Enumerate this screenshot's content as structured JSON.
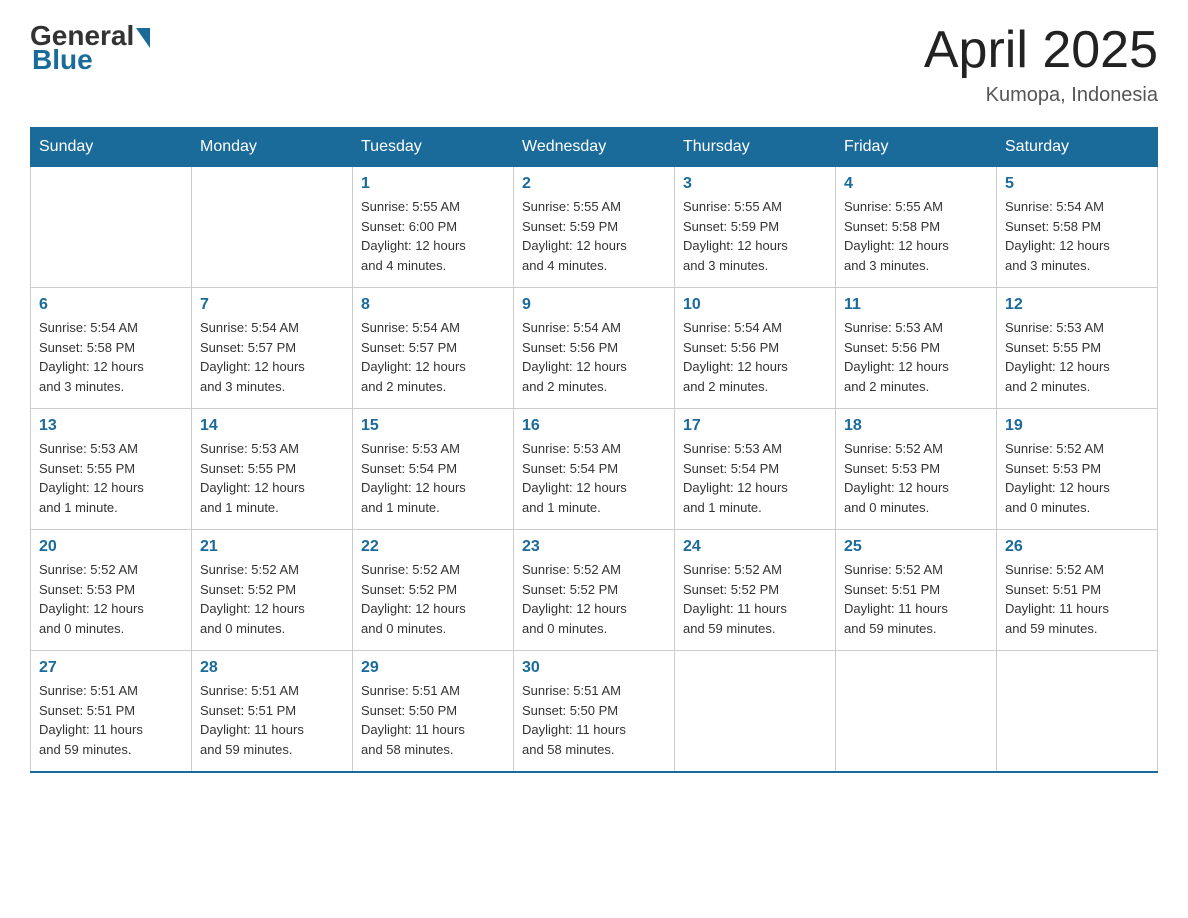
{
  "header": {
    "logo_general": "General",
    "logo_blue": "Blue",
    "month_title": "April 2025",
    "location": "Kumopa, Indonesia"
  },
  "weekdays": [
    "Sunday",
    "Monday",
    "Tuesday",
    "Wednesday",
    "Thursday",
    "Friday",
    "Saturday"
  ],
  "weeks": [
    [
      {
        "day": "",
        "info": ""
      },
      {
        "day": "",
        "info": ""
      },
      {
        "day": "1",
        "info": "Sunrise: 5:55 AM\nSunset: 6:00 PM\nDaylight: 12 hours\nand 4 minutes."
      },
      {
        "day": "2",
        "info": "Sunrise: 5:55 AM\nSunset: 5:59 PM\nDaylight: 12 hours\nand 4 minutes."
      },
      {
        "day": "3",
        "info": "Sunrise: 5:55 AM\nSunset: 5:59 PM\nDaylight: 12 hours\nand 3 minutes."
      },
      {
        "day": "4",
        "info": "Sunrise: 5:55 AM\nSunset: 5:58 PM\nDaylight: 12 hours\nand 3 minutes."
      },
      {
        "day": "5",
        "info": "Sunrise: 5:54 AM\nSunset: 5:58 PM\nDaylight: 12 hours\nand 3 minutes."
      }
    ],
    [
      {
        "day": "6",
        "info": "Sunrise: 5:54 AM\nSunset: 5:58 PM\nDaylight: 12 hours\nand 3 minutes."
      },
      {
        "day": "7",
        "info": "Sunrise: 5:54 AM\nSunset: 5:57 PM\nDaylight: 12 hours\nand 3 minutes."
      },
      {
        "day": "8",
        "info": "Sunrise: 5:54 AM\nSunset: 5:57 PM\nDaylight: 12 hours\nand 2 minutes."
      },
      {
        "day": "9",
        "info": "Sunrise: 5:54 AM\nSunset: 5:56 PM\nDaylight: 12 hours\nand 2 minutes."
      },
      {
        "day": "10",
        "info": "Sunrise: 5:54 AM\nSunset: 5:56 PM\nDaylight: 12 hours\nand 2 minutes."
      },
      {
        "day": "11",
        "info": "Sunrise: 5:53 AM\nSunset: 5:56 PM\nDaylight: 12 hours\nand 2 minutes."
      },
      {
        "day": "12",
        "info": "Sunrise: 5:53 AM\nSunset: 5:55 PM\nDaylight: 12 hours\nand 2 minutes."
      }
    ],
    [
      {
        "day": "13",
        "info": "Sunrise: 5:53 AM\nSunset: 5:55 PM\nDaylight: 12 hours\nand 1 minute."
      },
      {
        "day": "14",
        "info": "Sunrise: 5:53 AM\nSunset: 5:55 PM\nDaylight: 12 hours\nand 1 minute."
      },
      {
        "day": "15",
        "info": "Sunrise: 5:53 AM\nSunset: 5:54 PM\nDaylight: 12 hours\nand 1 minute."
      },
      {
        "day": "16",
        "info": "Sunrise: 5:53 AM\nSunset: 5:54 PM\nDaylight: 12 hours\nand 1 minute."
      },
      {
        "day": "17",
        "info": "Sunrise: 5:53 AM\nSunset: 5:54 PM\nDaylight: 12 hours\nand 1 minute."
      },
      {
        "day": "18",
        "info": "Sunrise: 5:52 AM\nSunset: 5:53 PM\nDaylight: 12 hours\nand 0 minutes."
      },
      {
        "day": "19",
        "info": "Sunrise: 5:52 AM\nSunset: 5:53 PM\nDaylight: 12 hours\nand 0 minutes."
      }
    ],
    [
      {
        "day": "20",
        "info": "Sunrise: 5:52 AM\nSunset: 5:53 PM\nDaylight: 12 hours\nand 0 minutes."
      },
      {
        "day": "21",
        "info": "Sunrise: 5:52 AM\nSunset: 5:52 PM\nDaylight: 12 hours\nand 0 minutes."
      },
      {
        "day": "22",
        "info": "Sunrise: 5:52 AM\nSunset: 5:52 PM\nDaylight: 12 hours\nand 0 minutes."
      },
      {
        "day": "23",
        "info": "Sunrise: 5:52 AM\nSunset: 5:52 PM\nDaylight: 12 hours\nand 0 minutes."
      },
      {
        "day": "24",
        "info": "Sunrise: 5:52 AM\nSunset: 5:52 PM\nDaylight: 11 hours\nand 59 minutes."
      },
      {
        "day": "25",
        "info": "Sunrise: 5:52 AM\nSunset: 5:51 PM\nDaylight: 11 hours\nand 59 minutes."
      },
      {
        "day": "26",
        "info": "Sunrise: 5:52 AM\nSunset: 5:51 PM\nDaylight: 11 hours\nand 59 minutes."
      }
    ],
    [
      {
        "day": "27",
        "info": "Sunrise: 5:51 AM\nSunset: 5:51 PM\nDaylight: 11 hours\nand 59 minutes."
      },
      {
        "day": "28",
        "info": "Sunrise: 5:51 AM\nSunset: 5:51 PM\nDaylight: 11 hours\nand 59 minutes."
      },
      {
        "day": "29",
        "info": "Sunrise: 5:51 AM\nSunset: 5:50 PM\nDaylight: 11 hours\nand 58 minutes."
      },
      {
        "day": "30",
        "info": "Sunrise: 5:51 AM\nSunset: 5:50 PM\nDaylight: 11 hours\nand 58 minutes."
      },
      {
        "day": "",
        "info": ""
      },
      {
        "day": "",
        "info": ""
      },
      {
        "day": "",
        "info": ""
      }
    ]
  ]
}
